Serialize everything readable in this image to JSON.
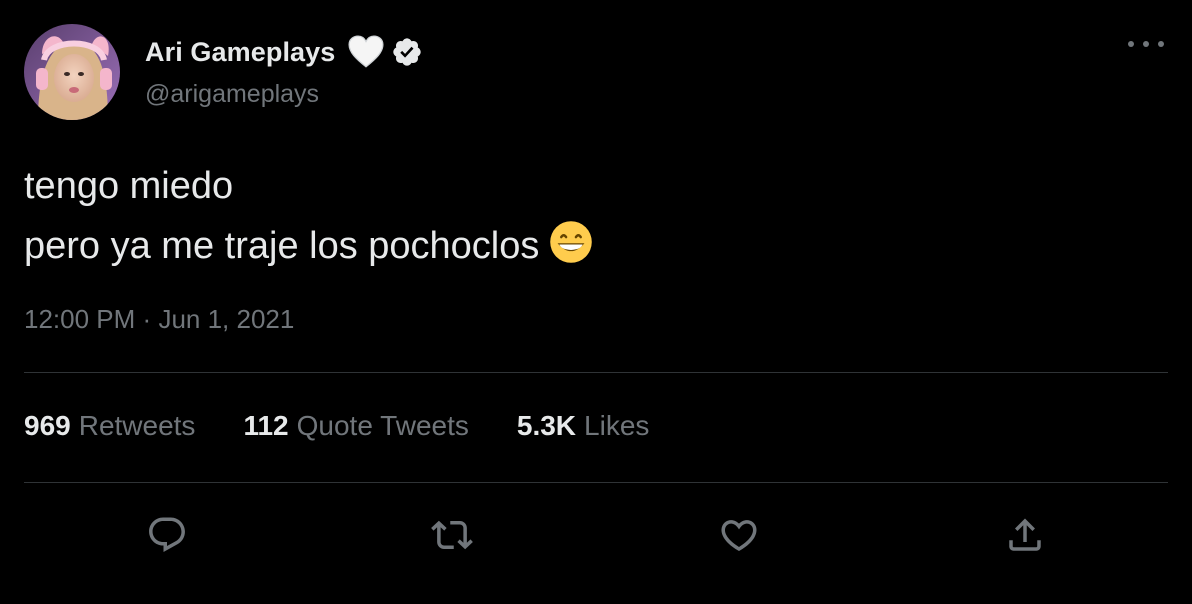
{
  "author": {
    "display_name": "Ari Gameplays",
    "handle": "@arigameplays",
    "name_emoji": "white-heart-icon",
    "verified": true
  },
  "tweet": {
    "lines": [
      "tengo miedo",
      "pero ya me traje los pochoclos"
    ],
    "emoji": "grinning-face-icon",
    "time": "12:00 PM",
    "separator": "·",
    "date": "Jun 1, 2021"
  },
  "stats": {
    "retweets": {
      "count": "969",
      "label": "Retweets"
    },
    "quotes": {
      "count": "112",
      "label": "Quote Tweets"
    },
    "likes": {
      "count": "5.3K",
      "label": "Likes"
    }
  },
  "colors": {
    "background": "#000000",
    "text_primary": "#e7e9ea",
    "text_secondary": "#71767b",
    "divider": "#2f3336"
  }
}
